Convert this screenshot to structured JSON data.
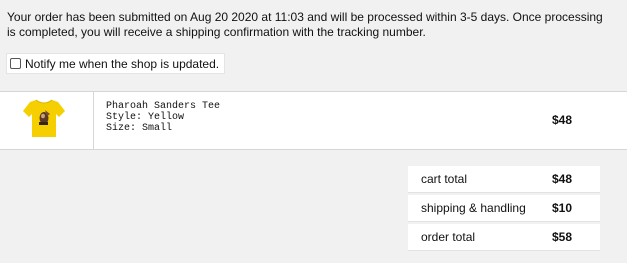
{
  "confirmation": {
    "message": "Your order has been submitted on Aug 20 2020 at 11:03 and will be processed within 3-5 days. Once processing is completed, you will receive a shipping confirmation with the tracking number."
  },
  "notify": {
    "label": "Notify me when the shop is updated.",
    "checked": false
  },
  "cart": {
    "items": [
      {
        "thumbnail_icon": "yellow-tshirt-image",
        "name": "Pharoah Sanders Tee",
        "style": "Style: Yellow",
        "size": "Size: Small",
        "price": "$48"
      }
    ]
  },
  "totals": [
    {
      "label": "cart total",
      "value": "$48"
    },
    {
      "label": "shipping & handling",
      "value": "$10"
    },
    {
      "label": "order total",
      "value": "$58"
    }
  ],
  "colors": {
    "background": "#f1f1f1",
    "panel": "#ffffff",
    "shirt": "#f6cf00"
  }
}
